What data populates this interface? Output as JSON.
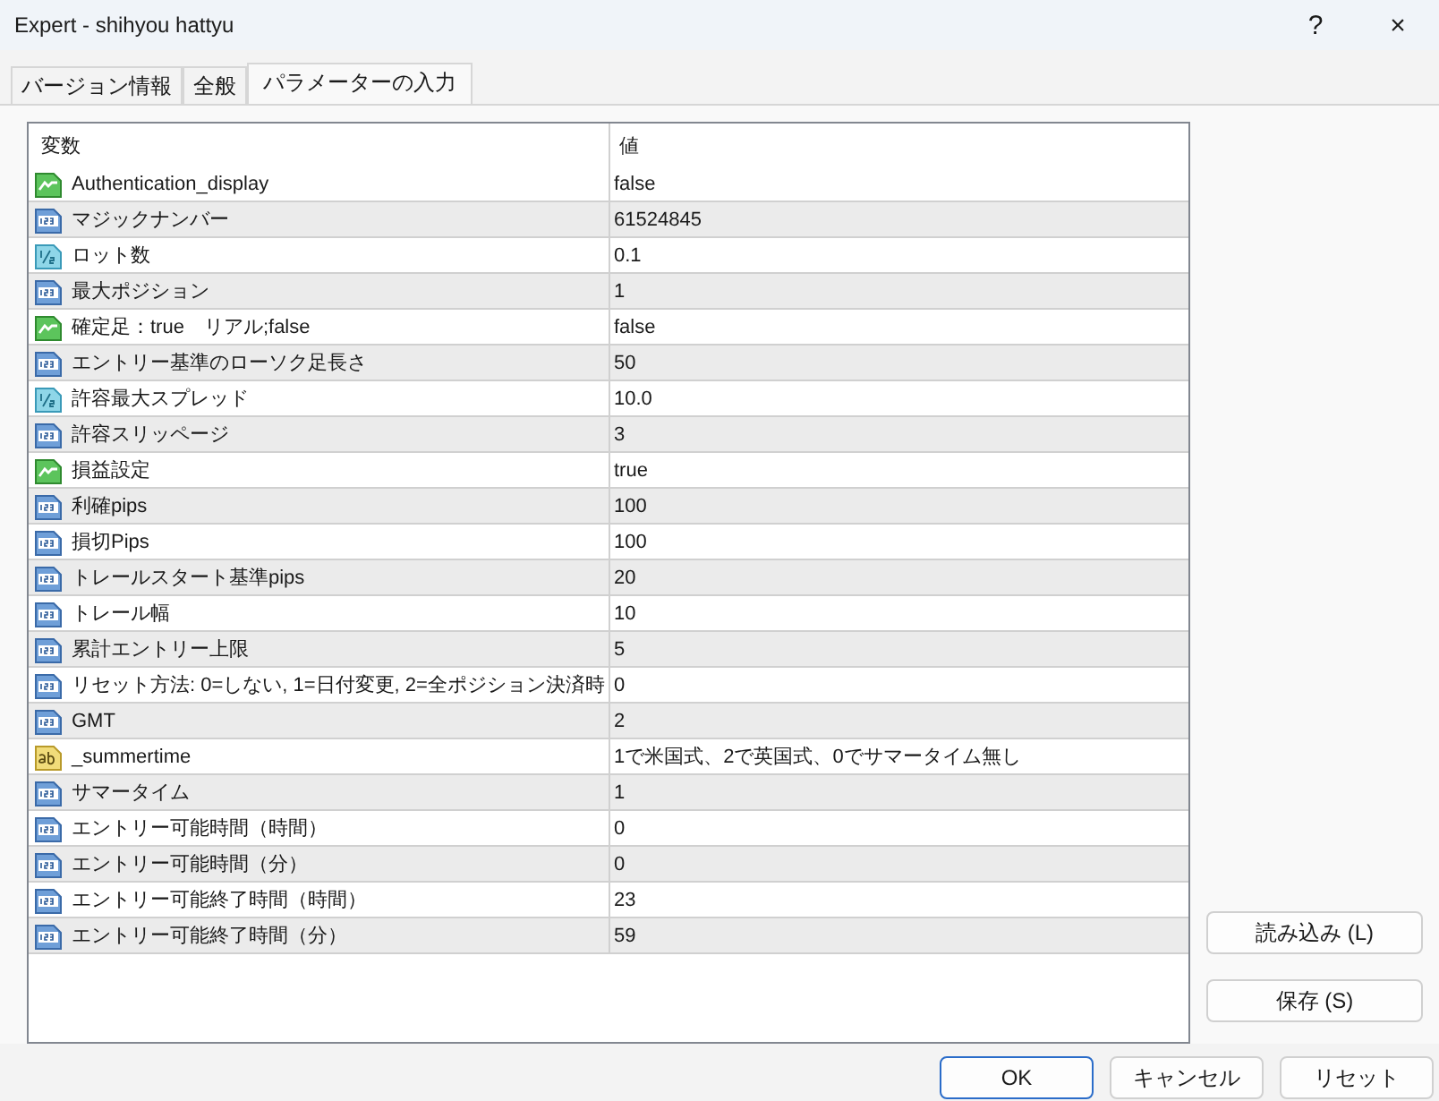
{
  "window": {
    "title": "Expert - shihyou hattyu",
    "help": "?",
    "close": "×"
  },
  "tabs": [
    {
      "label": "バージョン情報",
      "selected": false
    },
    {
      "label": "全般",
      "selected": false
    },
    {
      "label": "パラメーターの入力",
      "selected": true
    }
  ],
  "table": {
    "columns": [
      "変数",
      "値"
    ],
    "rows": [
      {
        "kind": "bool",
        "name": "Authentication_display",
        "value": "false"
      },
      {
        "kind": "int",
        "name": "マジックナンバー",
        "value": "61524845"
      },
      {
        "kind": "double",
        "name": "ロット数",
        "value": "0.1"
      },
      {
        "kind": "int",
        "name": "最大ポジション",
        "value": "1"
      },
      {
        "kind": "bool",
        "name": "確定足：true　リアル;false",
        "value": "false"
      },
      {
        "kind": "int",
        "name": "エントリー基準のローソク足長さ",
        "value": "50"
      },
      {
        "kind": "double",
        "name": "許容最大スプレッド",
        "value": "10.0"
      },
      {
        "kind": "int",
        "name": "許容スリッページ",
        "value": "3"
      },
      {
        "kind": "bool",
        "name": "損益設定",
        "value": "true"
      },
      {
        "kind": "int",
        "name": "利確pips",
        "value": "100"
      },
      {
        "kind": "int",
        "name": "損切Pips",
        "value": "100"
      },
      {
        "kind": "int",
        "name": "トレールスタート基準pips",
        "value": "20"
      },
      {
        "kind": "int",
        "name": "トレール幅",
        "value": "10"
      },
      {
        "kind": "int",
        "name": "累計エントリー上限",
        "value": "5"
      },
      {
        "kind": "int",
        "name": "リセット方法: 0=しない, 1=日付変更, 2=全ポジション決済時",
        "value": "0"
      },
      {
        "kind": "int",
        "name": "GMT",
        "value": "2"
      },
      {
        "kind": "string",
        "name": "_summertime",
        "value": "1で米国式、2で英国式、0でサマータイム無し"
      },
      {
        "kind": "int",
        "name": "サマータイム",
        "value": "1"
      },
      {
        "kind": "int",
        "name": "エントリー可能時間（時間）",
        "value": "0"
      },
      {
        "kind": "int",
        "name": "エントリー可能時間（分）",
        "value": "0"
      },
      {
        "kind": "int",
        "name": "エントリー可能終了時間（時間）",
        "value": "23"
      },
      {
        "kind": "int",
        "name": "エントリー可能終了時間（分）",
        "value": "59"
      }
    ]
  },
  "side_buttons": [
    "読み込み (L)",
    "保存 (S)"
  ],
  "buttons": [
    {
      "label": "OK",
      "default": true
    },
    {
      "label": "キャンセル",
      "default": false
    },
    {
      "label": "リセット",
      "default": false
    }
  ]
}
